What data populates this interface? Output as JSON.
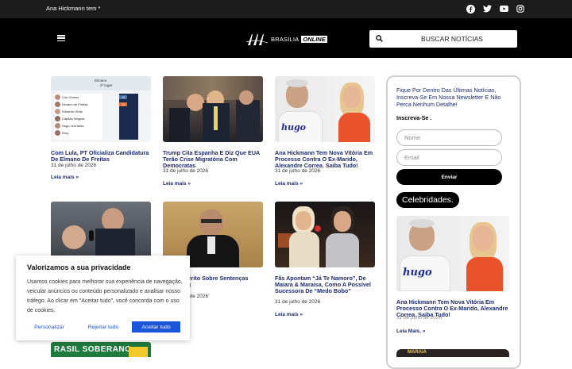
{
  "topbar": {
    "ticker": "Ana Hickmann tem *"
  },
  "header": {
    "logo_text": "BRASILIA",
    "logo_highlight": "ONLINE",
    "search_placeholder": "BUSCAR NOTÍCIAS"
  },
  "posts": [
    {
      "title": "Com Lula, PT Oficializa Candidatura De Elmano De Freitas",
      "date": "31 de julho de 2026",
      "more": "Leia mais »"
    },
    {
      "title": "Trump Cita Espanha E Diz Que EUA Terão Crise Migratória Com Democratas",
      "date": "31 de julho de 2026",
      "more": "Leia mais »"
    },
    {
      "title": "Ana Hickmann Tem Nova Vitória Em Processo Contra O Ex-Marido, Alexandre Correa. Saiba Tudo!",
      "date": "31 de julho de 2026",
      "more": "Leia mais »"
    },
    {
      "title": "uiva Inquérito Sobre Sentenças Contra Og",
      "date": "31 de julho de 2026"
    },
    {
      "title": "Fãs Apontam “Já Te Namoro”, De Maiara & Maraisa, Como A Possível Sucessora De “Medo Bobo”",
      "date": "31 de julho de 2026",
      "more": "Leia mais »"
    }
  ],
  "thumb_captions": {
    "poll_header_1": "Elmano",
    "poll_header_2": "2º lugar",
    "poll_names": [
      "Ciro Gomes",
      "Elmano de Freitas",
      "Eduardo Girão",
      "Capitão Wagner",
      "Hugo Leonardo",
      "Rory"
    ],
    "poll_values": [
      "43",
      "33"
    ],
    "shirt_text": "hugo",
    "banner_text": "RASIL SOBERANO"
  },
  "sidebar": {
    "intro": "Fique Por Dentro Das Últimas Notícias, Inscreva-Se Em Nossa Newsletter E Não Perca Nenhum Detalhe!",
    "subscribe_label": "Inscreva-Se .",
    "name_placeholder": "Nome",
    "email_placeholder": "Email",
    "send_label": "Enviar",
    "category": "Celebridades.",
    "feature_title": "Ana Hickmann Tem Nova Vitória Em Processo Contra O Ex-Marido, Alexandre Correa. Saiba Tudo!",
    "feature_date": "31 de julho de 2026",
    "feature_more": "Leia Mais. »",
    "thumb2_text": "MARAIA"
  },
  "cookie": {
    "title": "Valorizamos a sua privacidade",
    "text": "Usamos cookies para melhorar sua experiência de navegação, veicular anúncios ou conteúdo personalizado e analisar nosso tráfego. Ao clicar em \"Aceitar tudo\", você concorda com o uso de cookies.",
    "customize": "Personalizar",
    "reject": "Rejeitar tudo",
    "accept": "Aceitar tudo"
  },
  "colors": {
    "title_blue": "#1a2a6c",
    "accept_blue": "#1a56db",
    "header_bg": "#000000",
    "topbar_bg": "#1c1c1c"
  },
  "icons": [
    "facebook-icon",
    "twitter-icon",
    "youtube-icon",
    "instagram-icon",
    "menu-icon",
    "search-icon"
  ]
}
